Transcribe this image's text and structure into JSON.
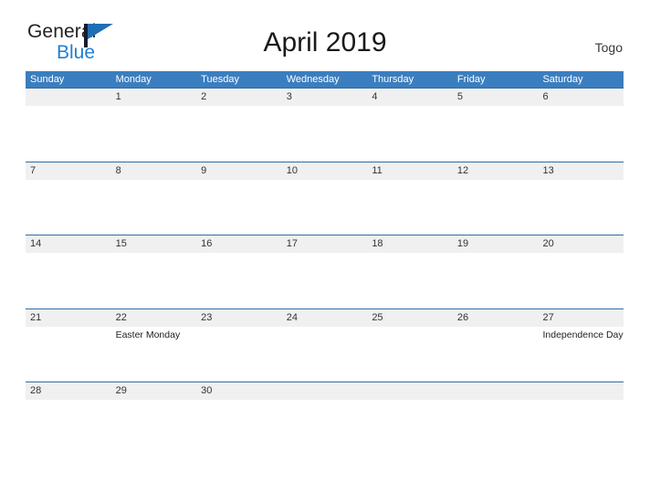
{
  "brand": {
    "name_part1": "General",
    "name_part2": "Blue",
    "flag_icon": "flag-icon"
  },
  "header": {
    "title": "April 2019",
    "country": "Togo"
  },
  "calendar": {
    "month": "April",
    "year": "2019",
    "weekday_headers": [
      "Sunday",
      "Monday",
      "Tuesday",
      "Wednesday",
      "Thursday",
      "Friday",
      "Saturday"
    ],
    "colors": {
      "header_blue": "#3b7ebf",
      "row_border": "#2e6da4",
      "date_band": "#f0f0f0",
      "brand_blue": "#1f7fd0",
      "text_dark": "#333333"
    },
    "weeks": [
      [
        {
          "day": "",
          "event": ""
        },
        {
          "day": "1",
          "event": ""
        },
        {
          "day": "2",
          "event": ""
        },
        {
          "day": "3",
          "event": ""
        },
        {
          "day": "4",
          "event": ""
        },
        {
          "day": "5",
          "event": ""
        },
        {
          "day": "6",
          "event": ""
        }
      ],
      [
        {
          "day": "7",
          "event": ""
        },
        {
          "day": "8",
          "event": ""
        },
        {
          "day": "9",
          "event": ""
        },
        {
          "day": "10",
          "event": ""
        },
        {
          "day": "11",
          "event": ""
        },
        {
          "day": "12",
          "event": ""
        },
        {
          "day": "13",
          "event": ""
        }
      ],
      [
        {
          "day": "14",
          "event": ""
        },
        {
          "day": "15",
          "event": ""
        },
        {
          "day": "16",
          "event": ""
        },
        {
          "day": "17",
          "event": ""
        },
        {
          "day": "18",
          "event": ""
        },
        {
          "day": "19",
          "event": ""
        },
        {
          "day": "20",
          "event": ""
        }
      ],
      [
        {
          "day": "21",
          "event": ""
        },
        {
          "day": "22",
          "event": "Easter Monday"
        },
        {
          "day": "23",
          "event": ""
        },
        {
          "day": "24",
          "event": ""
        },
        {
          "day": "25",
          "event": ""
        },
        {
          "day": "26",
          "event": ""
        },
        {
          "day": "27",
          "event": "Independence Day"
        }
      ],
      [
        {
          "day": "28",
          "event": ""
        },
        {
          "day": "29",
          "event": ""
        },
        {
          "day": "30",
          "event": ""
        },
        {
          "day": "",
          "event": ""
        },
        {
          "day": "",
          "event": ""
        },
        {
          "day": "",
          "event": ""
        },
        {
          "day": "",
          "event": ""
        }
      ]
    ]
  }
}
